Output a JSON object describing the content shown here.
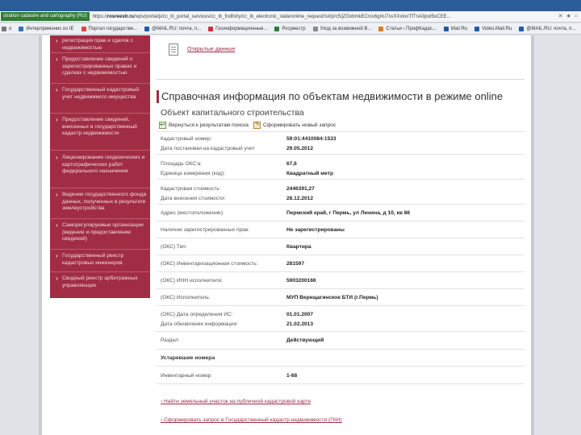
{
  "browser": {
    "site_badge": "stration cadastre and cartography (RU)",
    "url_prefix": "https://",
    "url_domain": "rosreestr.ru",
    "url_path": "/wps/portal/p/cc_ib_portal_services/cc_ib_fndfotry/cc_ib_electronic_state/online_request/!ut/p/c5/jZOxbmkECrxs6gnU7xvXXxkxrTfTnA3pot5oCEE...",
    "nav": [
      "✕",
      "★",
      "⌂"
    ],
    "bookmarks": [
      {
        "label": "o",
        "color": "#777"
      },
      {
        "label": "Интерпримонис из IE",
        "color": "#3b6fb3"
      },
      {
        "label": "Портал государстве...",
        "color": "#d44"
      },
      {
        "label": "@MAIL.RU: почта, п...",
        "color": "#1e5aa8"
      },
      {
        "label": "Госинформационные...",
        "color": "#c33"
      },
      {
        "label": "Росреестр",
        "color": "#2d7d32"
      },
      {
        "label": "Уход за возможной В...",
        "color": "#888"
      },
      {
        "label": "Статьи › ПрофКадас...",
        "color": "#d97b1f"
      },
      {
        "label": "Mail.Ru",
        "color": "#1e5aa8"
      },
      {
        "label": "Video.Mail.Ru",
        "color": "#1e5aa8"
      },
      {
        "label": "@MAIL.RU: почта, п...",
        "color": "#1e5aa8"
      }
    ]
  },
  "sidebar": {
    "items": [
      {
        "label": "регистрация прав и сделок с недвижимостью"
      },
      {
        "label": "Предоставление сведений о зарегистрированных правах и сделках с недвижимостью"
      },
      {
        "label": "Государственный кадастровый учет недвижимого имущества"
      },
      {
        "label": "Предоставление сведений, внесенных в государственный кадастр недвижимости"
      },
      {
        "label": "Лицензирование геодезических и картографических работ федерального назначения"
      },
      {
        "label": "Ведение государственного фонда данных, полученных в результате землеустройства"
      },
      {
        "label": "Саморегулируемые организации (ведение и предоставление сведений)"
      },
      {
        "label": "Государственный реестр кадастровых инженеров"
      },
      {
        "label": "Сводный реестр арбитражных управляющих"
      }
    ]
  },
  "open_data": {
    "label": "Открытые данные",
    "icon": "document-icon"
  },
  "main": {
    "title": "Справочная информация по объектам недвижимости в режиме online",
    "subtitle": "Объект капитального строительства",
    "actions": {
      "back": "Вернуться к результатам поиска",
      "new_request": "Сформировать новый запрос"
    }
  },
  "object": {
    "rows": [
      {
        "label": "Кадастровый номер:",
        "value": "59:01:4410084:1533"
      },
      {
        "label": "Дата постановки на кадастровый учет",
        "value": "29.05.2012"
      },
      {
        "label": "Площадь ОКС'а:",
        "value": "67,6"
      },
      {
        "label": "Единица измерения (код):",
        "value": "Квадратный метр"
      },
      {
        "label": "Кадастровая стоимость:",
        "value": "2446391,27"
      },
      {
        "label": "Дата внесения стоимости:",
        "value": "28.12.2012"
      },
      {
        "label": "Адрес (местоположение):",
        "value": "Пермский край, г Пермь, ул Ленина, д 10, кв 86"
      },
      {
        "label": "Наличие зарегистрированных прав:",
        "value": "Не зарегистрированы"
      },
      {
        "label": "(ОКС) Тип:",
        "value": "Квартира"
      },
      {
        "label": "(ОКС) Инвентаризационная стоимость:",
        "value": "281597"
      },
      {
        "label": "(ОКС) ИНН исполнителя:",
        "value": "5903200166"
      },
      {
        "label": "(ОКС) Исполнитель:",
        "value": "МУП Верещагинское БТИ (г.Пермь)"
      },
      {
        "label": "(ОКС) Дата определения ИС:",
        "value": "01.01.2007"
      },
      {
        "label": "Дата обновления информации:",
        "value": "21.02.2013"
      },
      {
        "label": "Раздел",
        "value": "Действующий"
      }
    ],
    "section": "Устаревшие номера",
    "old_numbers": [
      {
        "label": "Инвентарный номер",
        "value": "1-68"
      }
    ]
  },
  "links": {
    "find_land": "› Найти земельный участок на публичной кадастровой карте",
    "request_gkn": "› Сформировать запрос в Государственный кадастр недвижимости (ГКН)"
  }
}
